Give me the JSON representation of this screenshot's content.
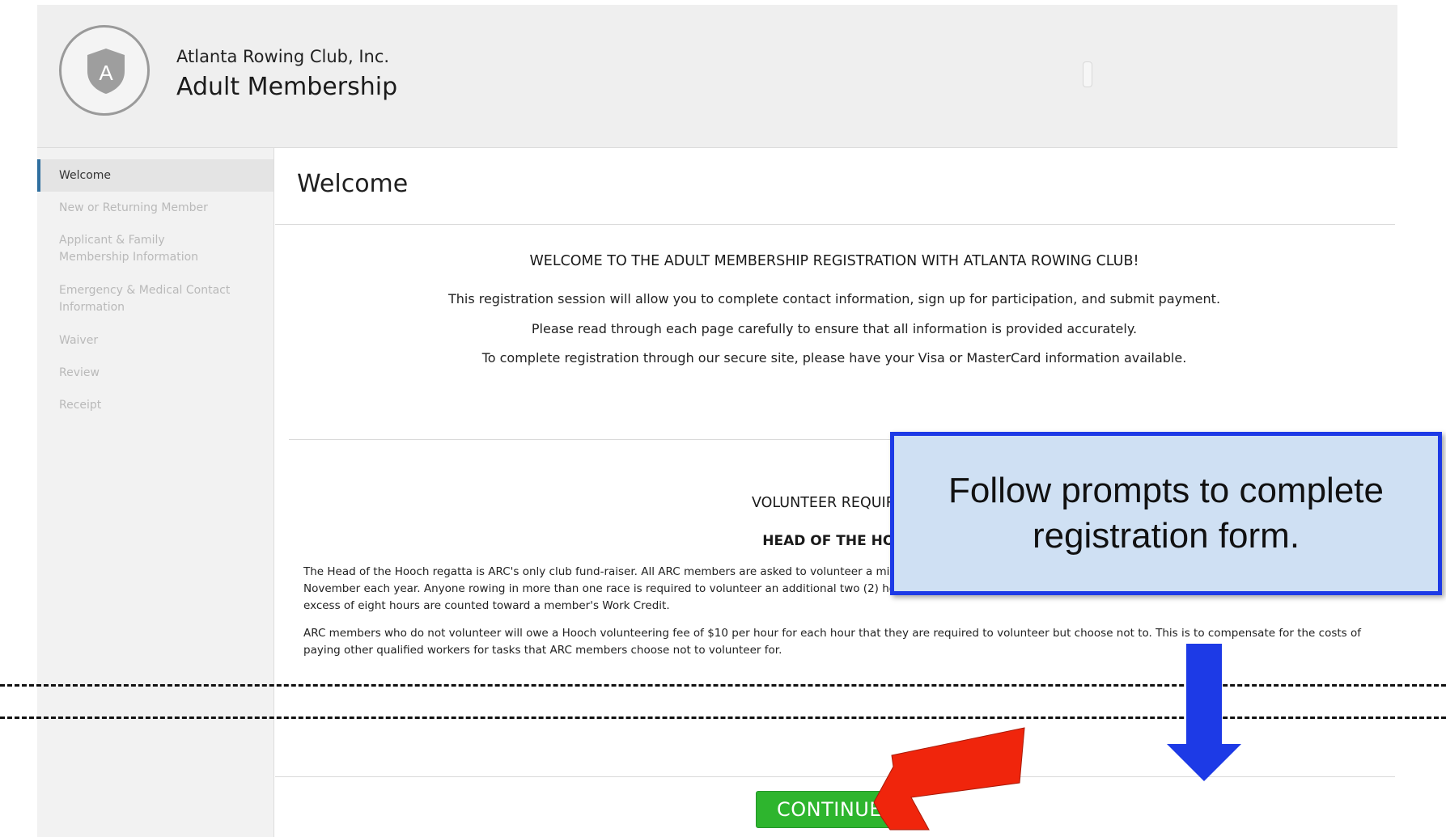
{
  "header": {
    "org_name": "Atlanta Rowing Club, Inc.",
    "program_name": "Adult Membership",
    "logo_letter": "A"
  },
  "sidebar": {
    "items": [
      {
        "label": "Welcome",
        "active": true
      },
      {
        "label": "New or Returning Member"
      },
      {
        "label": "Applicant & Family Membership Information"
      },
      {
        "label": "Emergency & Medical Contact Information"
      },
      {
        "label": "Waiver"
      },
      {
        "label": "Review"
      },
      {
        "label": "Receipt"
      }
    ]
  },
  "main": {
    "title": "Welcome",
    "welcome_heading": "WELCOME TO THE ADULT MEMBERSHIP REGISTRATION WITH ATLANTA ROWING CLUB!",
    "welcome_lines": [
      "This registration session will allow you to complete contact information, sign up for participation, and submit payment.",
      "Please read through each page carefully to ensure that all information is provided accurately.",
      "To complete registration through our secure site, please have your Visa or MasterCard information available."
    ],
    "volunteer_heading": "VOLUNTEER REQUIREM",
    "hooch_heading": "HEAD OF THE HOO",
    "paragraph1_lines": [
      "The Head of the Hooch regatta is ARC's only club fund-raiser. All ARC members are asked to volunteer a mini",
      "November each year. Anyone rowing in more than one race is required to volunteer an additional two (2) hou",
      "excess of eight hours are counted toward a member's Work Credit."
    ],
    "paragraph2_lines": [
      "ARC members who do not volunteer will owe a Hooch volunteering fee of $10 per hour for each hour that they are required to volunteer but choose not to. This is to compensate for the costs of",
      "paying other qualified workers for tasks that ARC members choose not to volunteer for."
    ],
    "continue_label": "CONTINUE"
  },
  "annotation": {
    "callout_text": "Follow prompts to complete registration form.",
    "callout_color": "#cfe0f3",
    "callout_border": "#1d3ae6",
    "arrow_blue": "#1d3ae6",
    "arrow_red": "#f0250c"
  }
}
